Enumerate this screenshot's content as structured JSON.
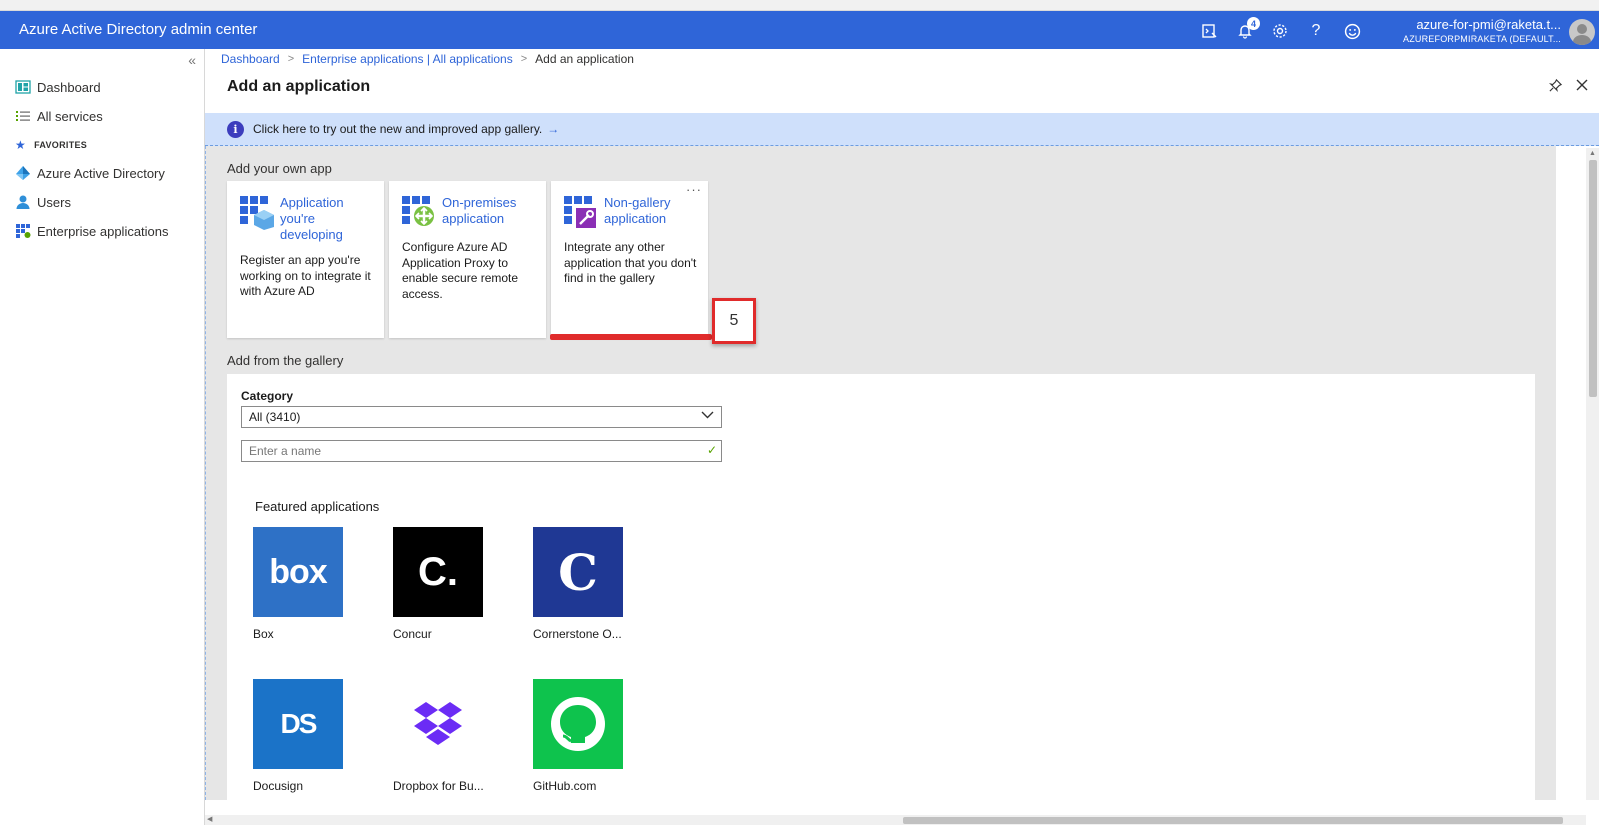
{
  "app": {
    "title": "Azure Active Directory admin center"
  },
  "header": {
    "notification_count": "4",
    "account_name": "azure-for-pmi@raketa.t...",
    "account_tenant": "AZUREFORPMIRAKETA (DEFAULT..."
  },
  "sidebar": {
    "items": [
      {
        "label": "Dashboard",
        "icon": "dashboard-icon"
      },
      {
        "label": "All services",
        "icon": "list-icon"
      }
    ],
    "favorites_label": "FAVORITES",
    "favorites": [
      {
        "label": "Azure Active Directory",
        "icon": "azure-ad-icon"
      },
      {
        "label": "Users",
        "icon": "user-icon"
      },
      {
        "label": "Enterprise applications",
        "icon": "enterprise-apps-icon"
      }
    ]
  },
  "breadcrumb": {
    "items": [
      "Dashboard",
      "Enterprise applications | All applications"
    ],
    "current": "Add an application"
  },
  "blade": {
    "title": "Add an application",
    "info_text": "Click here to try out the new and improved app gallery.",
    "info_arrow": "→"
  },
  "own_app": {
    "heading": "Add your own app",
    "tiles": [
      {
        "title": "Application you're developing",
        "description": "Register an app you're working on to integrate it with Azure AD"
      },
      {
        "title": "On-premises application",
        "description": "Configure Azure AD Application Proxy to enable secure remote access."
      },
      {
        "title": "Non-gallery application",
        "description": "Integrate any other application that you don't find in the gallery"
      }
    ],
    "more_label": "···",
    "step_number": "5"
  },
  "gallery": {
    "heading": "Add from the gallery",
    "category_label": "Category",
    "category_value": "All (3410)",
    "search_placeholder": "Enter a name",
    "featured_heading": "Featured applications",
    "apps": [
      {
        "name": "Box",
        "logo_text": "box",
        "color": "#2e71c6"
      },
      {
        "name": "Concur",
        "logo_text": "C.",
        "color": "#000000"
      },
      {
        "name": "Cornerstone O...",
        "logo_text": "C",
        "color": "#1f3894"
      },
      {
        "name": "Docusign",
        "logo_text": "DS",
        "color": "#1b73c8"
      },
      {
        "name": "Dropbox for Bu...",
        "logo_text": "",
        "color": "#ffffff"
      },
      {
        "name": "GitHub.com",
        "logo_text": "",
        "color": "#0ec34d"
      }
    ]
  },
  "colors": {
    "accent": "#2f65d8",
    "highlight": "#e02b2b",
    "info_bg": "#cfe0fb"
  }
}
